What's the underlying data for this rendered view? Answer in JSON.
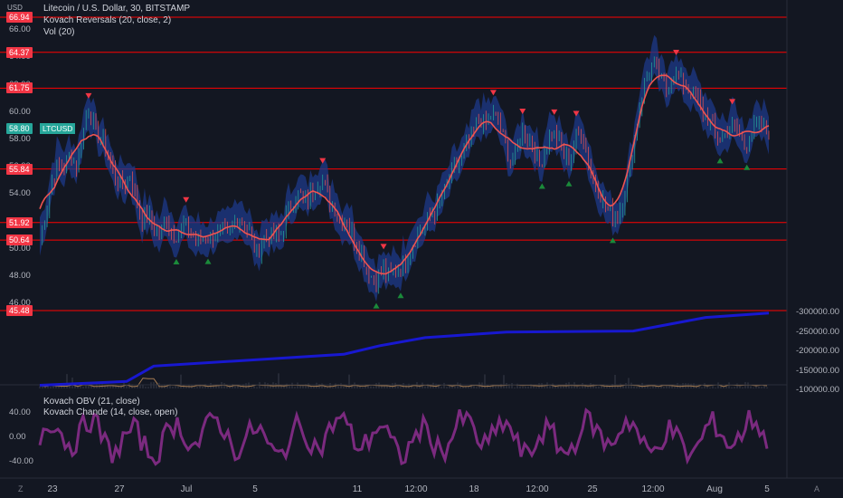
{
  "header": {
    "currency": "USD",
    "title": "Litecoin / U.S. Dollar, 30, BITSTAMP",
    "indicator1": "Kovach Reversals (20, close, 2)",
    "indicator2": "Vol (20)",
    "lower_ind1": "Kovach OBV (21, close)",
    "lower_ind2": "Kovach Chande (14, close, open)"
  },
  "price_axis": [
    "66.00",
    "64.00",
    "62.00",
    "60.00",
    "58.00",
    "56.00",
    "54.00",
    "52.00",
    "50.00",
    "48.00",
    "46.00"
  ],
  "horizontal_levels": [
    {
      "label": "66.94",
      "value": 66.94
    },
    {
      "label": "64.37",
      "value": 64.37
    },
    {
      "label": "61.75",
      "value": 61.75
    },
    {
      "label": "55.84",
      "value": 55.84
    },
    {
      "label": "51.92",
      "value": 51.92
    },
    {
      "label": "50.64",
      "value": 50.64
    },
    {
      "label": "45.48",
      "value": 45.48
    }
  ],
  "current_price": {
    "label": "58.80",
    "symbol": "LTCUSD",
    "value": 58.8
  },
  "lower_axis": [
    "40.00",
    "0.00",
    "-40.00"
  ],
  "right_axis": [
    "-100000.00",
    "-150000.00",
    "-200000.00",
    "-250000.00",
    "-300000.00"
  ],
  "time_axis": [
    "23",
    "27",
    "Jul",
    "5",
    "11",
    "12:00",
    "18",
    "12:00",
    "25",
    "12:00",
    "Aug",
    "5"
  ],
  "corner_left": "Z",
  "corner_right": "A",
  "colors": {
    "bg": "#131722",
    "level_line": "#ff0000",
    "level_tag": "#f23645",
    "price_tag": "#26a69a",
    "candle_up": "#26a69a",
    "candle_down": "#ef5350",
    "band": "#1e3a8a",
    "ma": "#ef5350",
    "obv": "#1818d0",
    "chande": "#7b2a7f",
    "vol": "#a67c52"
  },
  "chart_data": {
    "type": "line",
    "ylim": [
      45.5,
      67.5
    ],
    "close_path": [
      50.6,
      52.5,
      55.0,
      56.2,
      55.8,
      57.0,
      56.0,
      58.0,
      60.3,
      59.0,
      58.0,
      57.5,
      56.0,
      55.0,
      54.5,
      55.5,
      53.5,
      52.0,
      52.5,
      51.5,
      50.8,
      52.5,
      51.0,
      51.0,
      51.8,
      51.2,
      50.5,
      50.8,
      50.8,
      51.2,
      51.2,
      51.0,
      51.5,
      52.5,
      51.8,
      51.0,
      49.5,
      50.8,
      51.0,
      50.8,
      51.0,
      52.5,
      53.5,
      54.0,
      53.5,
      54.0,
      54.8,
      55.0,
      53.8,
      53.0,
      51.8,
      52.0,
      51.0,
      50.0,
      49.0,
      48.0,
      47.8,
      48.5,
      48.0,
      48.5,
      48.5,
      49.5,
      50.5,
      51.2,
      51.8,
      52.5,
      53.0,
      54.0,
      55.0,
      56.0,
      56.5,
      57.5,
      58.5,
      59.5,
      59.0,
      59.8,
      59.5,
      58.0,
      56.5,
      57.0,
      58.5,
      58.0,
      57.5,
      56.0,
      57.5,
      58.5,
      58.0,
      56.8,
      56.5,
      58.0,
      58.5,
      56.5,
      55.0,
      54.0,
      53.0,
      52.5,
      52.5,
      54.0,
      56.0,
      59.0,
      61.5,
      63.0,
      63.5,
      62.5,
      61.5,
      63.0,
      62.5,
      62.0,
      61.5,
      61.0,
      60.0,
      59.5,
      58.5,
      58.0,
      58.5,
      59.0,
      58.5,
      57.5,
      58.5,
      59.0,
      59.0,
      58.5
    ],
    "obv_series": "declining from about -120000 to -300000",
    "chande_range": [
      -50,
      60
    ]
  }
}
